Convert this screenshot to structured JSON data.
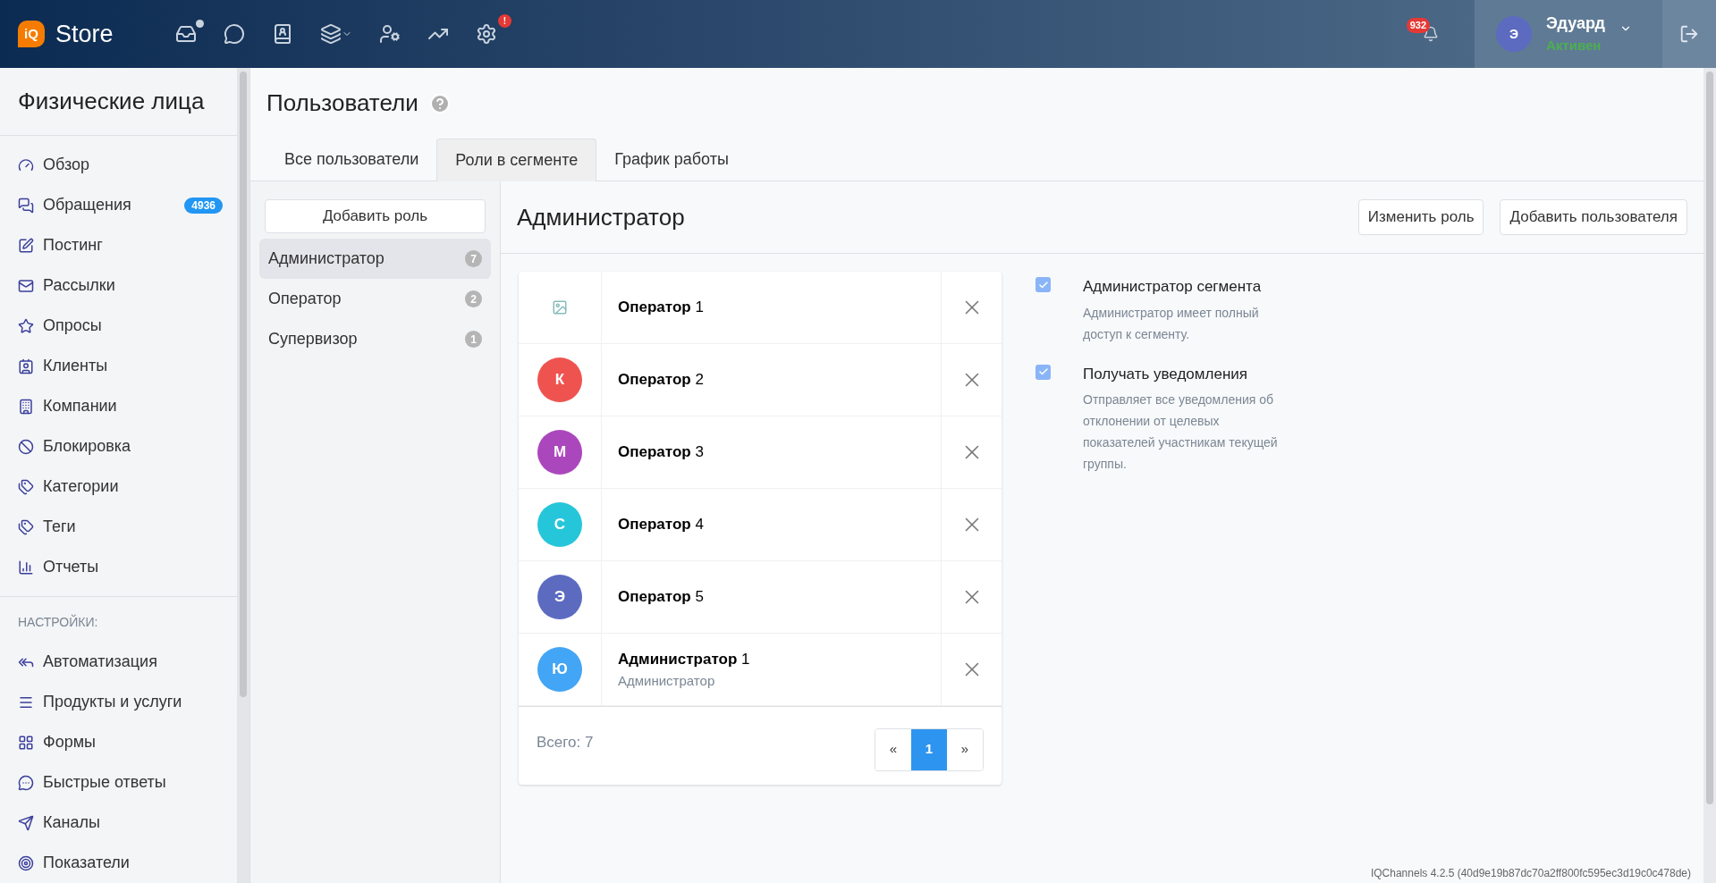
{
  "header": {
    "logo_text": "iQ",
    "app_name": "Store",
    "nav_icons": [
      {
        "indicator": true
      },
      {
        "indicator": false
      },
      {
        "indicator": false
      },
      {
        "indicator": false
      },
      {
        "indicator": false
      },
      {
        "indicator": false
      },
      {
        "indicator": false,
        "badge": "!"
      }
    ],
    "notifications_badge": "932",
    "user": {
      "initial": "Э",
      "name": "Эдуард",
      "status": "Активен"
    }
  },
  "sidebar": {
    "title": "Физические лица",
    "items": [
      {
        "label": "Обзор"
      },
      {
        "label": "Обращения",
        "badge": "4936"
      },
      {
        "label": "Постинг"
      },
      {
        "label": "Рассылки"
      },
      {
        "label": "Опросы"
      },
      {
        "label": "Клиенты"
      },
      {
        "label": "Компании"
      },
      {
        "label": "Блокировка"
      },
      {
        "label": "Категории"
      },
      {
        "label": "Теги"
      },
      {
        "label": "Отчеты"
      }
    ],
    "section_label": "НАСТРОЙКИ:",
    "settings_items": [
      {
        "label": "Автоматизация"
      },
      {
        "label": "Продукты и услуги"
      },
      {
        "label": "Формы"
      },
      {
        "label": "Быстрые ответы"
      },
      {
        "label": "Каналы"
      },
      {
        "label": "Показатели"
      }
    ]
  },
  "page": {
    "title": "Пользователи",
    "tabs": [
      {
        "label": "Все пользователи",
        "selected": false
      },
      {
        "label": "Роли в сегменте",
        "selected": true
      },
      {
        "label": "График работы",
        "selected": false
      }
    ],
    "add_role_button": "Добавить роль",
    "roles": [
      {
        "name": "Администратор",
        "count": "7",
        "selected": true
      },
      {
        "name": "Оператор",
        "count": "2",
        "selected": false
      },
      {
        "name": "Супервизор",
        "count": "1",
        "selected": false
      }
    ],
    "role_title": "Администратор",
    "buttons": [
      "Изменить роль",
      "Добавить пользователя"
    ],
    "members": [
      {
        "kind": "photo",
        "name": "Оператор",
        "number": "1"
      },
      {
        "kind": "initial",
        "initial": "К",
        "color": "#ef5350",
        "name": "Оператор",
        "number": "2"
      },
      {
        "kind": "initial",
        "initial": "М",
        "color": "#ab47bc",
        "name": "Оператор",
        "number": "3"
      },
      {
        "kind": "initial",
        "initial": "С",
        "color": "#26c6da",
        "name": "Оператор",
        "number": "4"
      },
      {
        "kind": "initial",
        "initial": "Э",
        "color": "#5c6bc0",
        "name": "Оператор",
        "number": "5"
      },
      {
        "kind": "initial",
        "initial": "Ю",
        "color": "#42a5f5",
        "name": "Администратор",
        "number": "1",
        "subtitle": "Администратор"
      }
    ],
    "total": "Всего: 7",
    "pagination": [
      {
        "label": "«",
        "selected": false
      },
      {
        "label": "1",
        "selected": true
      },
      {
        "label": "»",
        "selected": false
      }
    ],
    "permissions": [
      {
        "label": "Администратор сегмента",
        "description": "Администратор имеет полный доступ к сегменту.",
        "checked": true
      },
      {
        "label": "Получать уведомления",
        "description": "Отправляет все уведомления об отклонении от целевых показателей участникам текущей группы.",
        "checked": true
      }
    ],
    "version": "IQChannels 4.2.5 (40d9e19b87dc70a2ff800fc595ec3d19c0c478de)"
  }
}
